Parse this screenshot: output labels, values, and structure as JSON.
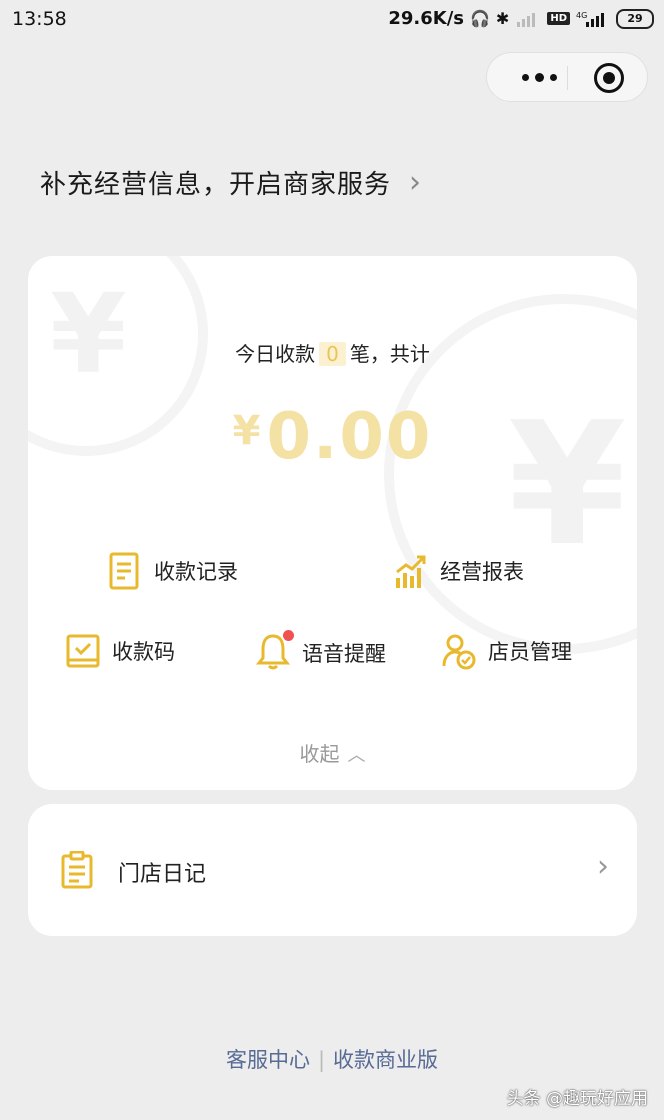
{
  "status_bar": {
    "time": "13:58",
    "speed": "29.6K/s",
    "network": "4G",
    "hd_badge": "HD",
    "battery": "29"
  },
  "capsule": {
    "more_icon": "more-dots-icon",
    "close_icon": "target-close-icon"
  },
  "merchant_prompt": {
    "text": "补充经营信息，开启商家服务",
    "chevron": "›"
  },
  "summary": {
    "prefix": "今日收款",
    "count": "0",
    "suffix": "笔，共计",
    "currency": "¥",
    "amount": "0.00"
  },
  "actions": {
    "records": "收款记录",
    "report": "经营报表",
    "qrcode": "收款码",
    "voice": "语音提醒",
    "staff": "店员管理"
  },
  "collapse_label": "收起",
  "diary": {
    "label": "门店日记"
  },
  "footer": {
    "service": "客服中心",
    "separator": "|",
    "business": "收款商业版"
  },
  "watermark": "头条 @趣玩好应用",
  "colors": {
    "accent": "#e8b92d",
    "amount": "#f4e1a4",
    "link": "#576b95",
    "badge": "#f05151"
  }
}
